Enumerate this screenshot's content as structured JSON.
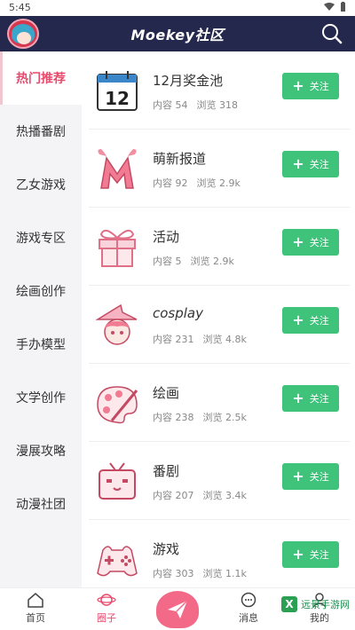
{
  "status_bar": {
    "time": "5:45"
  },
  "header": {
    "title": "Moekey社区"
  },
  "sidebar": {
    "items": [
      {
        "label": "热门推荐",
        "active": true
      },
      {
        "label": "热播番剧"
      },
      {
        "label": "乙女游戏"
      },
      {
        "label": "游戏专区"
      },
      {
        "label": "绘画创作"
      },
      {
        "label": "手办模型"
      },
      {
        "label": "文学创作"
      },
      {
        "label": "漫展攻略"
      },
      {
        "label": "动漫社团"
      }
    ]
  },
  "communities": [
    {
      "name": "12月奖金池",
      "content": "内容 54",
      "views": "浏览 318",
      "follow": "关注",
      "icon": "calendar-12-icon"
    },
    {
      "name": "萌新报道",
      "content": "内容 92",
      "views": "浏览 2.9k",
      "follow": "关注",
      "icon": "letter-m-icon"
    },
    {
      "name": "活动",
      "content": "内容 5",
      "views": "浏览 2.9k",
      "follow": "关注",
      "icon": "gift-icon"
    },
    {
      "name": "cosplay",
      "content": "内容 231",
      "views": "浏览 4.8k",
      "follow": "关注",
      "icon": "witch-girl-icon"
    },
    {
      "name": "绘画",
      "content": "内容 238",
      "views": "浏览 2.5k",
      "follow": "关注",
      "icon": "palette-icon"
    },
    {
      "name": "番剧",
      "content": "内容 207",
      "views": "浏览 3.4k",
      "follow": "关注",
      "icon": "tv-icon"
    },
    {
      "name": "游戏",
      "content": "内容 303",
      "views": "浏览 1.1k",
      "follow": "关注",
      "icon": "gamepad-icon"
    }
  ],
  "bottom_nav": {
    "home": "首页",
    "circle": "圈子",
    "messages": "消息",
    "mine": "我的"
  },
  "watermark": {
    "text": "远景手游网"
  },
  "colors": {
    "header": "#25284d",
    "accent": "#e84a6e",
    "follow": "#3fc37b"
  }
}
